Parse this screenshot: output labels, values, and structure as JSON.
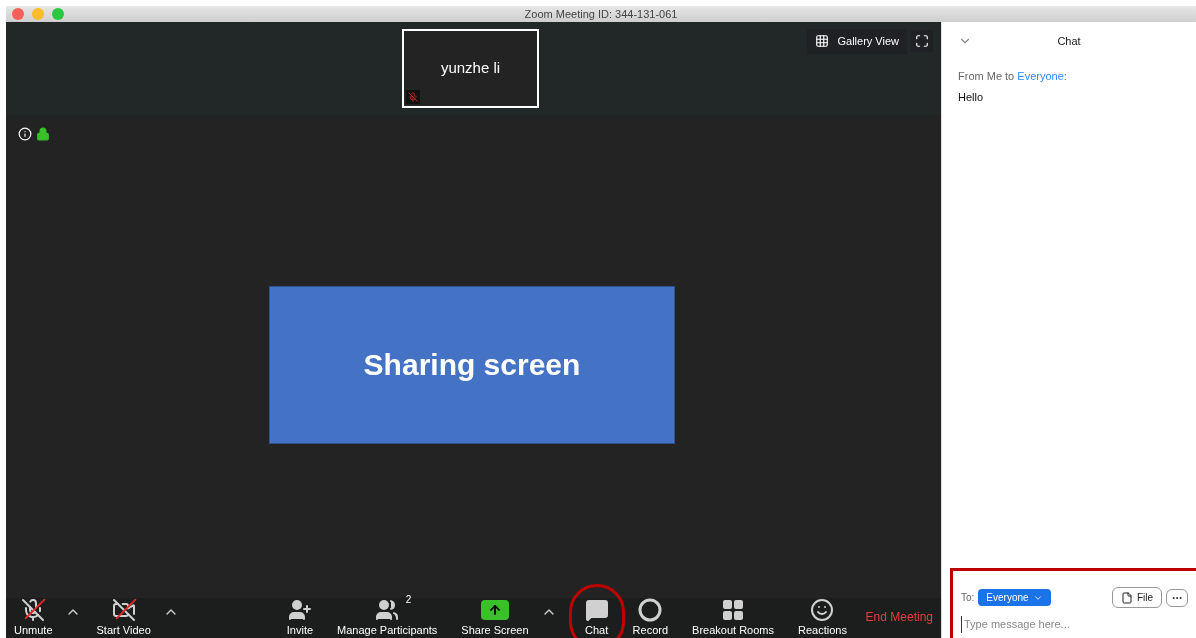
{
  "window": {
    "title": "Zoom Meeting ID: 344-131-061"
  },
  "thumbnail": {
    "name": "yunzhe li",
    "muted": true
  },
  "view_button": {
    "label": "Gallery View"
  },
  "shared_screen": {
    "text": "Sharing screen"
  },
  "toolbar": {
    "left": [
      {
        "kind": "mic",
        "label": "Unmute",
        "off": true,
        "caret": true,
        "highlighted": false
      },
      {
        "kind": "video",
        "label": "Start Video",
        "off": true,
        "caret": true,
        "highlighted": false
      }
    ],
    "center": [
      {
        "kind": "invite",
        "label": "Invite",
        "off": false,
        "caret": false,
        "highlighted": false
      },
      {
        "kind": "participants",
        "label": "Manage Participants",
        "count": "2",
        "off": false,
        "caret": false,
        "highlighted": false
      },
      {
        "kind": "share",
        "label": "Share Screen",
        "off": false,
        "caret": true,
        "highlighted": false
      },
      {
        "kind": "chat",
        "label": "Chat",
        "off": false,
        "caret": false,
        "highlighted": true
      },
      {
        "kind": "record",
        "label": "Record",
        "off": false,
        "caret": false,
        "highlighted": false
      },
      {
        "kind": "rooms",
        "label": "Breakout Rooms",
        "off": false,
        "caret": false,
        "highlighted": false
      },
      {
        "kind": "reactions",
        "label": "Reactions",
        "off": false,
        "caret": false,
        "highlighted": false
      }
    ],
    "end_button": "End Meeting"
  },
  "chat": {
    "title": "Chat",
    "messages": [
      {
        "from": "From Me to ",
        "to": "Everyone",
        "colon": ":",
        "text": "Hello"
      }
    ],
    "compose": {
      "to_label": "To:",
      "recipient": "Everyone",
      "file_button": "File",
      "placeholder": "Type message here...",
      "highlighted": true
    }
  }
}
